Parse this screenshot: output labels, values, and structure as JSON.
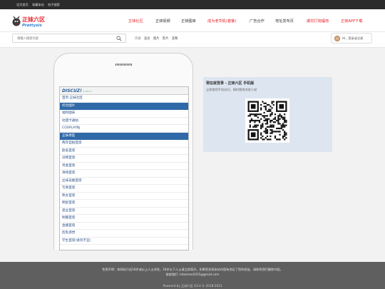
{
  "topbar": {
    "links": [
      "设为首页",
      "收藏本站",
      "帖子搜索"
    ]
  },
  "logo": {
    "text_cn": "正妹六区",
    "text_en": "Prettysix",
    "color_cn": "#e8262d",
    "color_en": "#2b7fd1"
  },
  "nav": {
    "items": [
      {
        "label": "正妹社区",
        "color": "#e8262d"
      },
      {
        "label": "正妹视频",
        "color": "#333333"
      },
      {
        "label": "正妹图库",
        "color": "#333333"
      },
      {
        "label": "成为老司机(套餐)",
        "color": "#e8262d"
      },
      {
        "label": "广告合作",
        "color": "#333333"
      },
      {
        "label": "地址发布页",
        "color": "#333333"
      },
      {
        "label": "爆究打炮福地",
        "color": "#e8262d"
      },
      {
        "label": "正妹APP下载",
        "color": "#e8262d"
      }
    ]
  },
  "search": {
    "placeholder": "请输入搜索内容",
    "hot_label": "热搜",
    "hot_words": [
      "美女",
      "图片",
      "影片",
      "美臀"
    ]
  },
  "login": {
    "label": "Hi，登录或注册"
  },
  "mobile": {
    "brand": "DISCUZ!",
    "brand_suffix": "mobile",
    "rows": [
      {
        "text": "首页·正妹社区",
        "type": "top"
      },
      {
        "text": "综合图片",
        "type": "cat"
      },
      {
        "text": "福利图床",
        "type": "item"
      },
      {
        "text": "动漫卡通帖",
        "type": "item"
      },
      {
        "text": "COSPLAY帖",
        "type": "item"
      },
      {
        "text": "正妹専區",
        "type": "cat"
      },
      {
        "text": "两岸自拍首席",
        "type": "item"
      },
      {
        "text": "欧美首席",
        "type": "item"
      },
      {
        "text": "日韩首席",
        "type": "item"
      },
      {
        "text": "另类首席",
        "type": "item"
      },
      {
        "text": "清纯首席",
        "type": "item"
      },
      {
        "text": "丝袜美腿首席",
        "type": "item"
      },
      {
        "text": "写真首席",
        "type": "item"
      },
      {
        "text": "熟女首席",
        "type": "item"
      },
      {
        "text": "明星首席",
        "type": "item"
      },
      {
        "text": "黑丝首席",
        "type": "item"
      },
      {
        "text": "制服首席",
        "type": "item"
      },
      {
        "text": "直播首席",
        "type": "item"
      },
      {
        "text": "韵乳感觉",
        "type": "item"
      },
      {
        "text": "学生首席(请勿不宜)",
        "type": "item"
      }
    ]
  },
  "qr": {
    "title": "現在就登录 - 正妹六区 手机版",
    "subtitle": "立即使用手机访问，随时随地浏览小说"
  },
  "footer": {
    "line1": "免责声明：本网站只适18岁或以上人士浏览，18岁以下人士请立即离开。如果您发现本站内容有违反了您的权益，请联系我们删除内容。",
    "line2": "联络我们: hdamme2015@gmail.com",
    "line3": "Powered by 正妹六区 X3.4 © 2018-2023"
  }
}
